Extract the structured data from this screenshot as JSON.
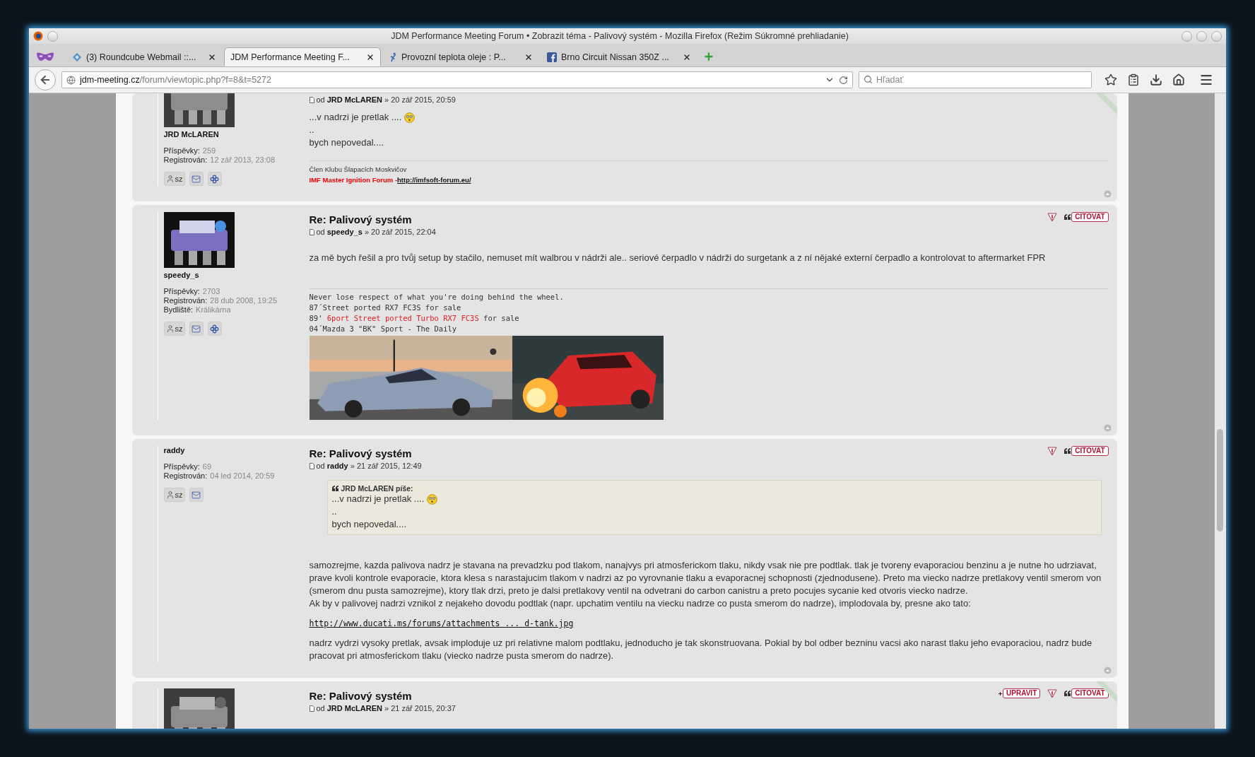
{
  "window": {
    "title": "JDM Performance Meeting Forum • Zobrazit téma - Palivový systém - Mozilla Firefox (Režim Súkromné prehliadanie)"
  },
  "tabs": [
    {
      "label": "(3) Roundcube Webmail ::...",
      "selected": false
    },
    {
      "label": "JDM Performance Meeting F...",
      "selected": true
    },
    {
      "label": "Provozní teplota oleje : P...",
      "selected": false
    },
    {
      "label": "Brno Circuit Nissan 350Z ...",
      "selected": false
    }
  ],
  "address": {
    "host": "jdm-meeting.cz",
    "path": "/forum/viewtopic.php?f=8&t=5272"
  },
  "search": {
    "placeholder": "Hľadať"
  },
  "posts": [
    {
      "author": "JRD McLAREN",
      "avatar": true,
      "online": true,
      "meta": {
        "prefix": "od",
        "author": "JRD McLAREN",
        "date": "» 20 zář 2015, 20:59"
      },
      "stats": [
        {
          "label": "Příspěvky:",
          "value": "259"
        },
        {
          "label": "Registrován:",
          "value": "12 zář 2013, 23:08"
        }
      ],
      "contacts": [
        {
          "kind": "pm",
          "label": "sz"
        },
        {
          "kind": "mail"
        },
        {
          "kind": "www"
        }
      ],
      "body": [
        {
          "kind": "lines",
          "lines": [
            {
              "text": "...v nadrzi je pretlak ....",
              "smiley": true
            },
            {
              "text": "..",
              "smiley": false
            },
            {
              "text": "bych nepovedal....",
              "smiley": false
            }
          ]
        }
      ],
      "signature": [
        {
          "kind": "small",
          "text": "Člen Klubu Šlapacích Moskvičov"
        },
        {
          "kind": "ad",
          "text": "IMF Master Ignition Forum - ",
          "link": "http://imfsoft-forum.eu/"
        }
      ]
    },
    {
      "author": "speedy_s",
      "avatar": true,
      "online": false,
      "title": "Re: Palivový systém",
      "meta": {
        "prefix": "od",
        "author": "speedy_s",
        "date": "» 20 zář 2015, 22:04"
      },
      "stats": [
        {
          "label": "Příspěvky:",
          "value": "2703"
        },
        {
          "label": "Registrován:",
          "value": "28 dub 2008, 19:25"
        },
        {
          "label": "Bydliště:",
          "value": "Králikárna"
        }
      ],
      "contacts": [
        {
          "kind": "pm",
          "label": "sz"
        },
        {
          "kind": "mail"
        },
        {
          "kind": "www"
        }
      ],
      "actions": [
        {
          "kind": "report"
        },
        {
          "kind": "quote",
          "label": "CITOVAT"
        }
      ],
      "body": [
        {
          "kind": "paragraph",
          "text": "za mě bych řešil a pro tvůj setup by stačilo, nemuset mít walbrou v nádrži ale.. seriové čerpadlo v nádrži do surgetank a z ní nějaké externí čerpadlo a kontrolovat to aftermarket FPR"
        }
      ],
      "signature": [
        {
          "kind": "plain",
          "text": "Never lose respect of what you're doing behind the wheel."
        },
        {
          "kind": "plain",
          "text": "87´Street ported RX7 FC3S for sale"
        },
        {
          "kind": "mixed",
          "before": "89' ",
          "red": "6port Street ported Turbo RX7 FC3S",
          "after": " for sale"
        },
        {
          "kind": "plain",
          "text": "04´Mazda 3 \"BK\" Sport - The Daily"
        },
        {
          "kind": "pictures"
        }
      ]
    },
    {
      "author": "raddy",
      "avatar": false,
      "online": false,
      "title": "Re: Palivový systém",
      "meta": {
        "prefix": "od",
        "author": "raddy",
        "date": "» 21 zář 2015, 12:49"
      },
      "stats": [
        {
          "label": "Příspěvky:",
          "value": "69"
        },
        {
          "label": "Registrován:",
          "value": "04 led 2014, 20:59"
        }
      ],
      "contacts": [
        {
          "kind": "pm",
          "label": "sz"
        },
        {
          "kind": "mail"
        }
      ],
      "actions": [
        {
          "kind": "report"
        },
        {
          "kind": "quote",
          "label": "CITOVAT"
        }
      ],
      "body": [
        {
          "kind": "quote",
          "author": "JRD McLAREN píše:",
          "lines": [
            {
              "text": "...v nadrzi je pretlak ....",
              "smiley": true
            },
            {
              "text": "..",
              "smiley": false
            },
            {
              "text": "bych nepovedal....",
              "smiley": false
            }
          ]
        },
        {
          "kind": "paragraph",
          "text": "samozrejme, kazda palivova nadrz je stavana na prevadzku pod tlakom, nanajvys pri atmosferickom tlaku, nikdy vsak nie pre podtlak. tlak je tvoreny evaporaciou benzinu a je nutne ho udrziavat, prave kvoli kontrole evaporacie, ktora klesa s narastajucim tlakom v nadrzi az po vyrovnanie tlaku a evaporacnej schopnosti (zjednodusene). Preto ma viecko nadrze pretlakovy ventil smerom von (smerom dnu pusta samozrejme), ktory tlak drzi, preto je dalsi pretlakovy ventil na odvetrani do carbon canistru a preto pocujes sycanie ked otvoris viecko nadrze."
        },
        {
          "kind": "paragraph_tight",
          "text": "Ak by v palivovej nadrzi vznikol z nejakeho dovodu podtlak (napr. upchatim ventilu na viecku nadrze co pusta smerom do nadrze), implodovala by, presne ako tato:"
        },
        {
          "kind": "link",
          "text": "http://www.ducati.ms/forums/attachments ... d-tank.jpg"
        },
        {
          "kind": "paragraph",
          "text": "nadrz vydrzi vysoky pretlak, avsak imploduje uz pri relativne malom podtlaku, jednoducho je tak skonstruovana. Pokial by bol odber bezninu vacsi ako narast tlaku jeho evaporaciou, nadrz bude pracovat pri atmosferickom tlaku (viecko nadrze pusta smerom do nadrze)."
        }
      ]
    },
    {
      "avatar": true,
      "online": true,
      "title": "Re: Palivový systém",
      "meta": {
        "prefix": "od",
        "author": "JRD McLAREN",
        "date": "» 21 zář 2015, 20:37"
      },
      "actions": [
        {
          "kind": "edit",
          "label": "UPRAVIT"
        },
        {
          "kind": "report"
        },
        {
          "kind": "quote",
          "label": "CITOVAT"
        }
      ]
    }
  ]
}
